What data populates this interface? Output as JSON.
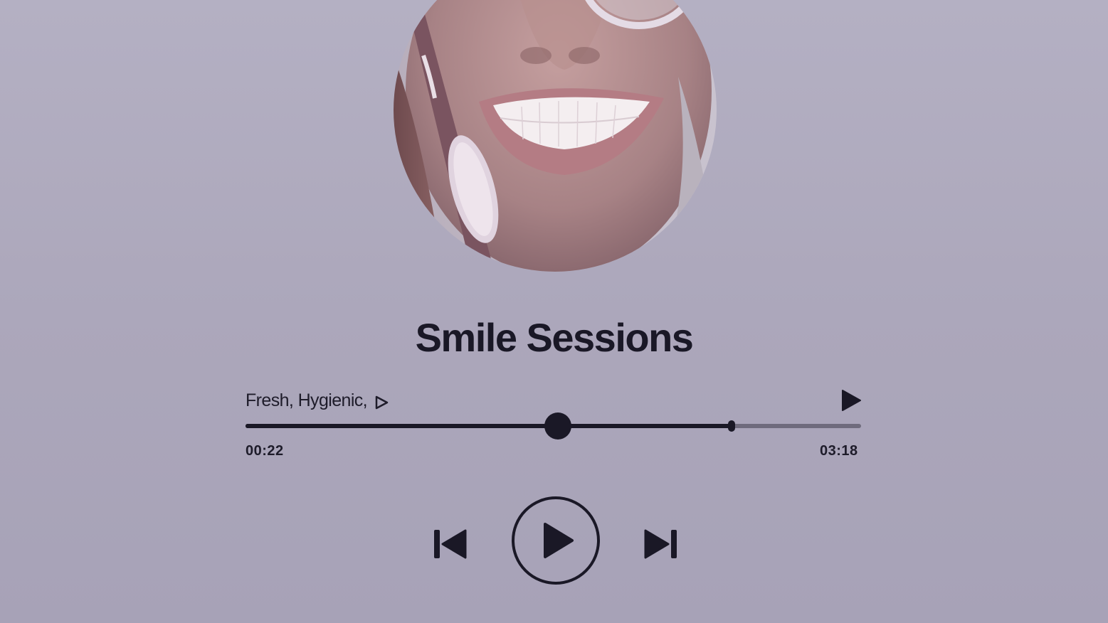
{
  "player": {
    "title": "Smile Sessions",
    "subtitle": "Fresh, Hygienic,",
    "subtitle_icon": "small-play-icon",
    "elapsed": "00:22",
    "total": "03:18",
    "progress_fraction": 0.507,
    "buffered_fraction": 0.79
  },
  "controls": {
    "previous_icon": "skip-previous-icon",
    "play_icon": "play-circle-icon",
    "next_icon": "skip-next-icon",
    "top_play_icon": "play-icon"
  },
  "colors": {
    "background": "#aeaabd",
    "foreground": "#1a1826",
    "track_rest": "#6f6b7d"
  }
}
